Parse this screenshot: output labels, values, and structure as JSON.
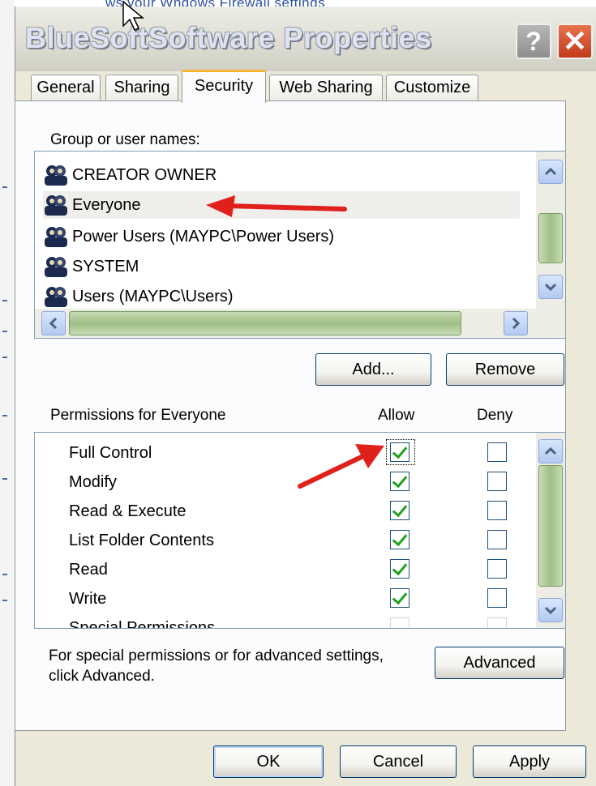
{
  "background": {
    "top_text": "ws your Wndows Firewall settings"
  },
  "window": {
    "title": "BlueSoftSoftware Properties",
    "help_label": "?",
    "close_label": "✕"
  },
  "tabs": [
    {
      "label": "General"
    },
    {
      "label": "Sharing"
    },
    {
      "label": "Security",
      "active": true
    },
    {
      "label": "Web Sharing"
    },
    {
      "label": "Customize"
    }
  ],
  "security": {
    "group_label": "Group or user names:",
    "users": [
      {
        "name": "CREATOR OWNER"
      },
      {
        "name": "Everyone",
        "selected": true
      },
      {
        "name": "Power Users (MAYPC\\Power Users)"
      },
      {
        "name": "SYSTEM"
      },
      {
        "name": "Users (MAYPC\\Users)"
      }
    ],
    "add_label": "Add...",
    "remove_label": "Remove",
    "permissions_label": "Permissions for Everyone",
    "allow_header": "Allow",
    "deny_header": "Deny",
    "permissions": [
      {
        "name": "Full Control",
        "allow": true,
        "deny": false
      },
      {
        "name": "Modify",
        "allow": true,
        "deny": false
      },
      {
        "name": "Read & Execute",
        "allow": true,
        "deny": false
      },
      {
        "name": "List Folder Contents",
        "allow": true,
        "deny": false
      },
      {
        "name": "Read",
        "allow": true,
        "deny": false
      },
      {
        "name": "Write",
        "allow": true,
        "deny": false
      },
      {
        "name": "Special Permissions",
        "allow": false,
        "deny": false
      }
    ],
    "advanced_note": "For special permissions or for advanced settings,\nclick Advanced.",
    "advanced_label": "Advanced"
  },
  "footer": {
    "ok_label": "OK",
    "cancel_label": "Cancel",
    "apply_label": "Apply"
  },
  "colors": {
    "annotation_arrow": "#e0201b",
    "check": "#21a121",
    "scroll_thumb": "#9ebf85"
  }
}
